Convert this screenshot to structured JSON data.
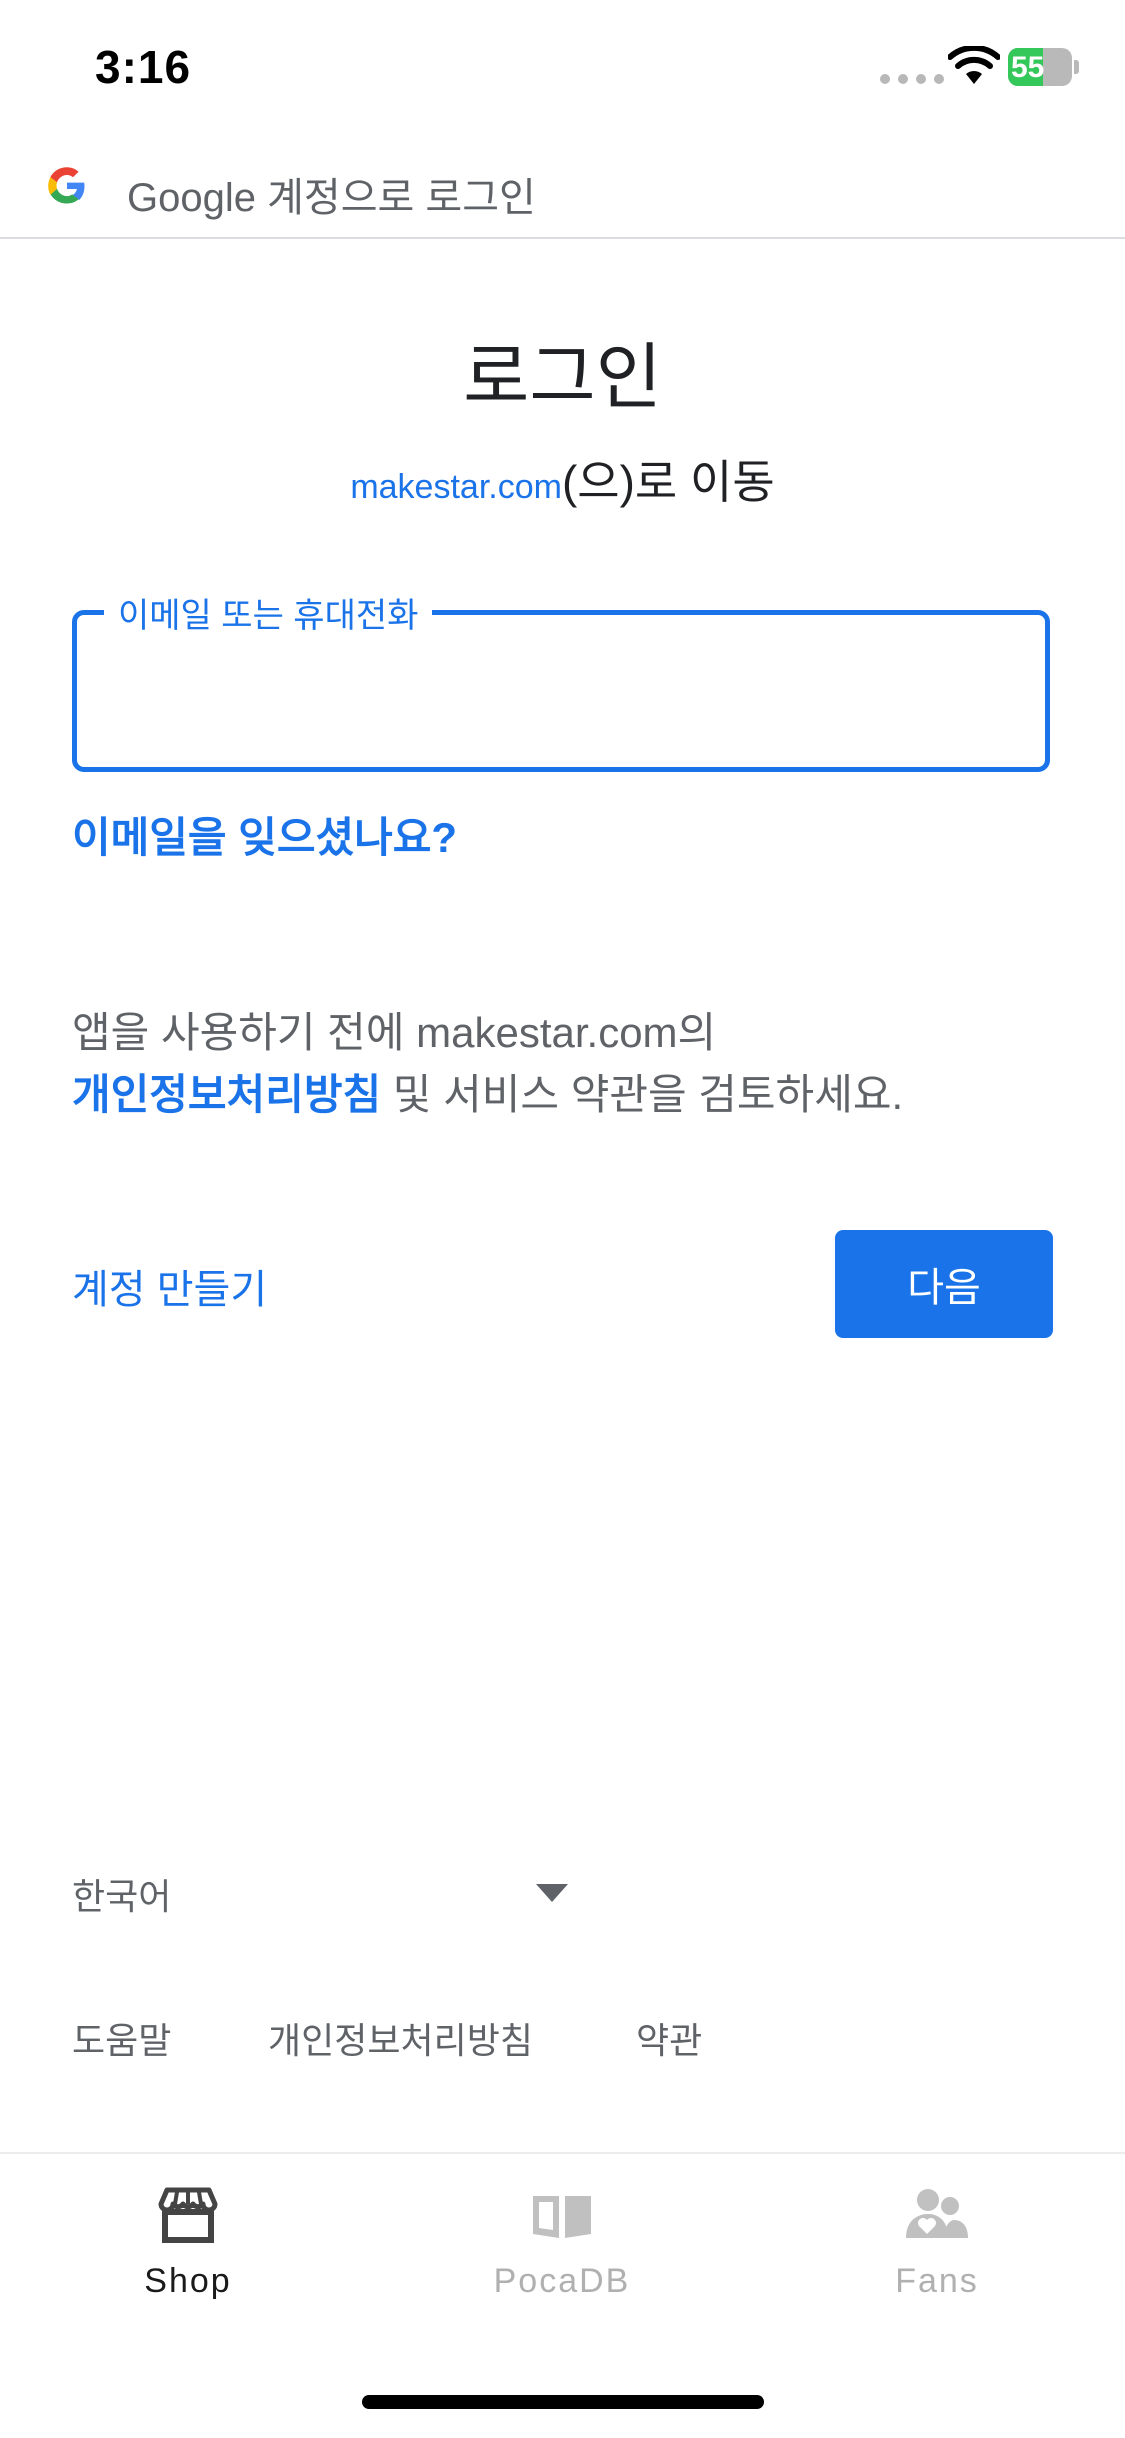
{
  "status_bar": {
    "time": "3:16",
    "battery": "55"
  },
  "header": {
    "title": "Google 계정으로 로그인"
  },
  "main": {
    "title": "로그인",
    "subtitle_domain": "makestar.com",
    "subtitle_rest": "(으)로 이동",
    "email_label": "이메일 또는 휴대전화",
    "email_value": "",
    "forgot_email": "이메일을 잊으셨나요?",
    "policy_line1": "앱을 사용하기 전에 makestar.com의",
    "policy_link": "개인정보처리방침",
    "policy_line2": " 및 서비스 약관을 검토하세요.",
    "create_account": "계정 만들기",
    "next_button": "다음"
  },
  "footer": {
    "language": "한국어",
    "help": "도움말",
    "privacy": "개인정보처리방침",
    "terms": "약관"
  },
  "tabbar": {
    "items": [
      {
        "label": "Shop",
        "icon": "store-icon",
        "active": true
      },
      {
        "label": "PocaDB",
        "icon": "book-icon",
        "active": false
      },
      {
        "label": "Fans",
        "icon": "fans-icon",
        "active": false
      }
    ]
  },
  "colors": {
    "accent": "#1a73e8",
    "battery": "#34c759"
  }
}
